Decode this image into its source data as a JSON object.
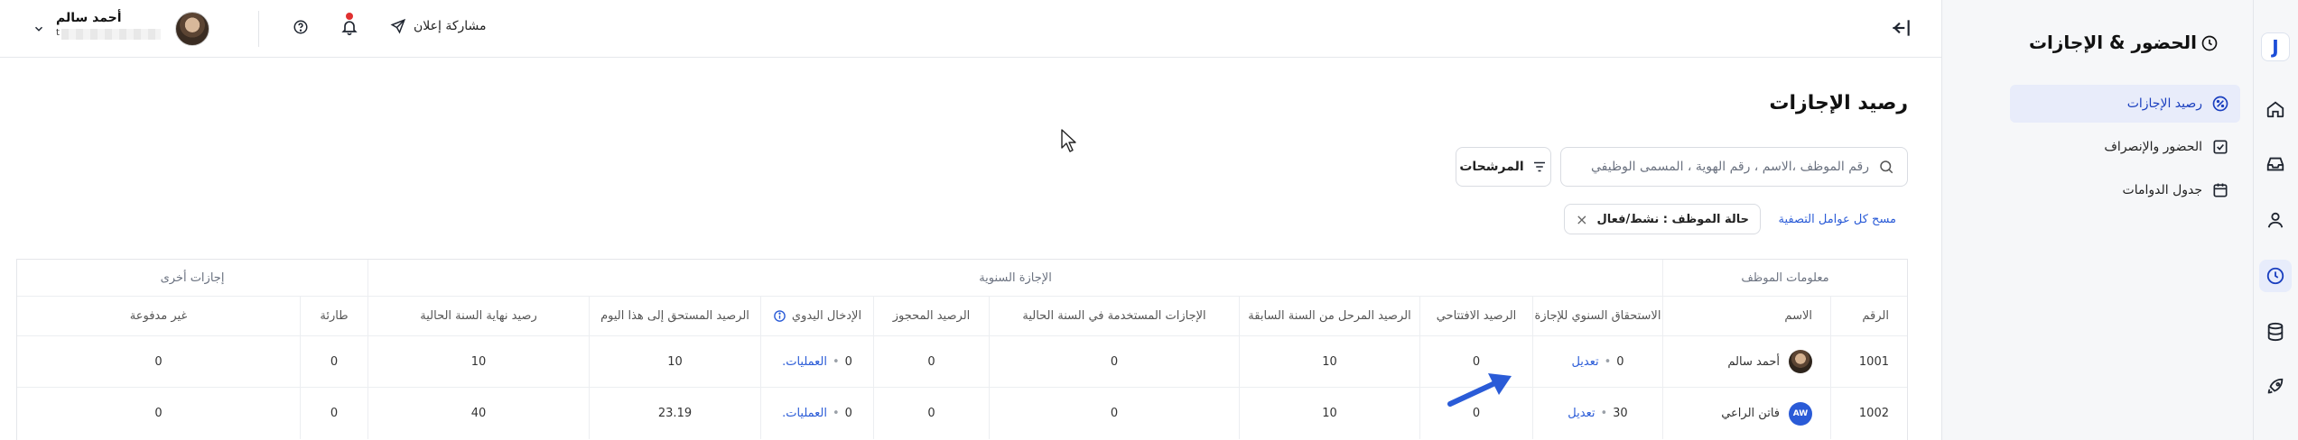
{
  "brand": {
    "logo_letter": "J"
  },
  "rail": {
    "icons": [
      "home-icon",
      "inbox-icon",
      "user-icon",
      "clock-icon",
      "database-icon",
      "rocket-icon"
    ]
  },
  "sidebar": {
    "title": "الحضور & الإجازات",
    "items": [
      {
        "label": "رصيد الإجازات",
        "icon": "percent-icon",
        "active": true
      },
      {
        "label": "الحضور والإنصراف",
        "icon": "check-square-icon",
        "active": false
      },
      {
        "label": "جدول الدوامات",
        "icon": "calendar-icon",
        "active": false
      }
    ]
  },
  "topbar": {
    "share_label": "مشاركة إعلان",
    "user_name": "أحمد سالم",
    "user_sub_suffix": "t"
  },
  "page": {
    "title": "رصيد الإجازات",
    "search_placeholder": "رقم الموظف ،الاسم ، رقم الهوية ، المسمى الوظيفي",
    "filters_label": "المرشحات",
    "clear_filters": "مسح كل عوامل التصفية",
    "chip_label": "حالة الموظف : نشط/فعال"
  },
  "table": {
    "groups": {
      "employee": "معلومات الموظف",
      "annual": "الإجازة السنوية",
      "other": "إجازات أخرى"
    },
    "headers": {
      "id": "الرقم",
      "name": "الاسم",
      "annual_entitlement": "الاستحقاق السنوي للإجازة",
      "opening_balance": "الرصيد الافتتاحي",
      "carried_over": "الرصيد المرحل من السنة السابقة",
      "used_current": "الإجازات المستخدمة في السنة الحالية",
      "reserved": "الرصيد المحجوز",
      "manual_entry": "الإدخال اليدوي",
      "due_today": "الرصيد المستحق إلى هذا اليوم",
      "year_end": "رصيد نهاية السنة الحالية",
      "emergency": "طارئة",
      "unpaid": "غير مدفوعة"
    },
    "rows": [
      {
        "id": "1001",
        "name": "أحمد سالم",
        "avatar": "photo",
        "annual_entitlement": "0",
        "edit_label": "تعديل",
        "opening_balance": "0",
        "carried_over": "10",
        "used_current": "0",
        "reserved": "0",
        "manual_entry": "0",
        "ops_label": "العمليات",
        "due_today": "10",
        "year_end": "10",
        "emergency": "0",
        "unpaid": "0"
      },
      {
        "id": "1002",
        "name": "فاتن الراعي",
        "avatar_initials": "AW",
        "annual_entitlement": "30",
        "edit_label": "تعديل",
        "opening_balance": "0",
        "carried_over": "10",
        "used_current": "0",
        "reserved": "0",
        "manual_entry": "0",
        "ops_label": "العمليات",
        "due_today": "23.19",
        "year_end": "40",
        "emergency": "0",
        "unpaid": "0"
      }
    ]
  },
  "colors": {
    "accent": "#2a5bd7",
    "active_bg": "#e8ecfa",
    "notification": "#e03030"
  }
}
